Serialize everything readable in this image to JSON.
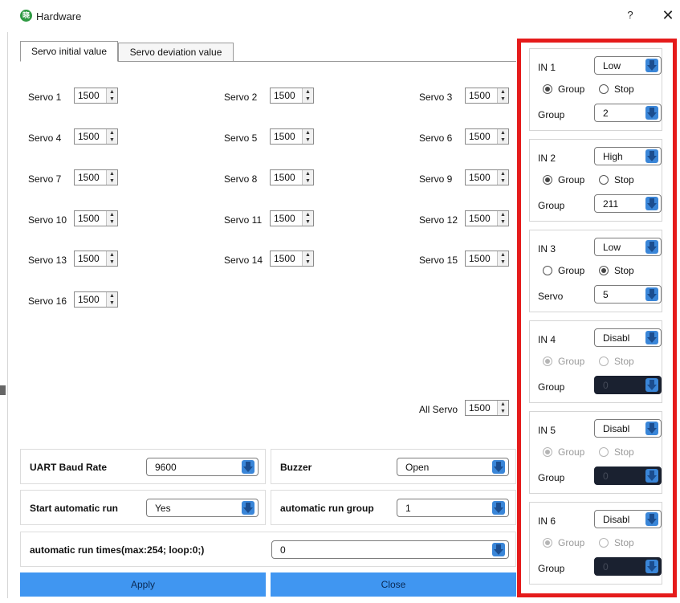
{
  "window": {
    "title": "Hardware",
    "help": "?",
    "close": "✕"
  },
  "tabs": [
    {
      "label": "Servo initial value"
    },
    {
      "label": "Servo deviation value"
    }
  ],
  "servos": [
    {
      "label": "Servo 1",
      "value": "1500"
    },
    {
      "label": "Servo 2",
      "value": "1500"
    },
    {
      "label": "Servo 3",
      "value": "1500"
    },
    {
      "label": "Servo 4",
      "value": "1500"
    },
    {
      "label": "Servo 5",
      "value": "1500"
    },
    {
      "label": "Servo 6",
      "value": "1500"
    },
    {
      "label": "Servo 7",
      "value": "1500"
    },
    {
      "label": "Servo 8",
      "value": "1500"
    },
    {
      "label": "Servo 9",
      "value": "1500"
    },
    {
      "label": "Servo 10",
      "value": "1500"
    },
    {
      "label": "Servo 11",
      "value": "1500"
    },
    {
      "label": "Servo 12",
      "value": "1500"
    },
    {
      "label": "Servo 13",
      "value": "1500"
    },
    {
      "label": "Servo 14",
      "value": "1500"
    },
    {
      "label": "Servo 15",
      "value": "1500"
    },
    {
      "label": "Servo 16",
      "value": "1500"
    }
  ],
  "all_servo": {
    "label": "All Servo",
    "value": "1500"
  },
  "settings": {
    "uart": {
      "label": "UART Baud Rate",
      "value": "9600"
    },
    "buzzer": {
      "label": "Buzzer",
      "value": "Open"
    },
    "auto_run": {
      "label": "Start automatic run",
      "value": "Yes"
    },
    "auto_group": {
      "label": "automatic run group",
      "value": "1"
    },
    "auto_times": {
      "label": "automatic run times(max:254; loop:0;)",
      "value": "0"
    }
  },
  "buttons": {
    "apply": "Apply",
    "close": "Close"
  },
  "inputs": [
    {
      "name": "IN 1",
      "level": "Low",
      "group_label": "Group",
      "stop_label": "Stop",
      "mode": "group",
      "sub_label": "Group",
      "sub_value": "2",
      "enabled": true
    },
    {
      "name": "IN 2",
      "level": "High",
      "group_label": "Group",
      "stop_label": "Stop",
      "mode": "group",
      "sub_label": "Group",
      "sub_value": "211",
      "enabled": true
    },
    {
      "name": "IN 3",
      "level": "Low",
      "group_label": "Group",
      "stop_label": "Stop",
      "mode": "stop",
      "sub_label": "Servo",
      "sub_value": "5",
      "enabled": true
    },
    {
      "name": "IN 4",
      "level": "Disabl",
      "group_label": "Group",
      "stop_label": "Stop",
      "mode": "group",
      "sub_label": "Group",
      "sub_value": "0",
      "enabled": false
    },
    {
      "name": "IN 5",
      "level": "Disabl",
      "group_label": "Group",
      "stop_label": "Stop",
      "mode": "group",
      "sub_label": "Group",
      "sub_value": "0",
      "enabled": false
    },
    {
      "name": "IN 6",
      "level": "Disabl",
      "group_label": "Group",
      "stop_label": "Stop",
      "mode": "group",
      "sub_label": "Group",
      "sub_value": "0",
      "enabled": false
    }
  ],
  "icons": {
    "logo": "app-logo-icon",
    "dropdown": "blue-down-arrow-icon",
    "spin": "spin-arrows-icon"
  },
  "colors": {
    "highlight_border": "#e51b1b",
    "button": "#4096f1",
    "arrow": "#3a86d8",
    "disabled_combo": "#1a2130"
  }
}
